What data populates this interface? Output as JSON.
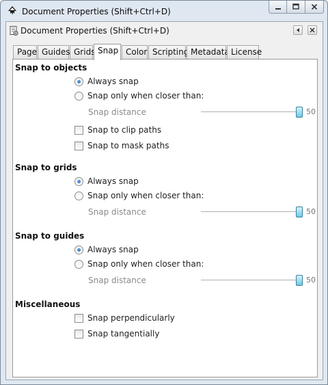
{
  "window": {
    "title": "Document Properties (Shift+Ctrl+D)",
    "dock_title": "Document Properties (Shift+Ctrl+D)"
  },
  "tabs": [
    {
      "id": "page",
      "label": "Page",
      "active": false
    },
    {
      "id": "guides",
      "label": "Guides",
      "active": false
    },
    {
      "id": "grids",
      "label": "Grids",
      "active": false
    },
    {
      "id": "snap",
      "label": "Snap",
      "active": true
    },
    {
      "id": "color",
      "label": "Color",
      "active": false
    },
    {
      "id": "scripting",
      "label": "Scripting",
      "active": false
    },
    {
      "id": "metadata",
      "label": "Metadata",
      "active": false
    },
    {
      "id": "license",
      "label": "License",
      "active": false
    }
  ],
  "snap_objects": {
    "title": "Snap to objects",
    "always_snap": "Always snap",
    "closer_than": "Snap only when closer than:",
    "distance_label": "Snap distance",
    "distance_value": "50",
    "clip_paths": "Snap to clip paths",
    "mask_paths": "Snap to mask paths"
  },
  "snap_grids": {
    "title": "Snap to grids",
    "always_snap": "Always snap",
    "closer_than": "Snap only when closer than:",
    "distance_label": "Snap distance",
    "distance_value": "50"
  },
  "snap_guides": {
    "title": "Snap to guides",
    "always_snap": "Always snap",
    "closer_than": "Snap only when closer than:",
    "distance_label": "Snap distance",
    "distance_value": "50"
  },
  "misc": {
    "title": "Miscellaneous",
    "perpendicularly": "Snap perpendicularly",
    "tangentially": "Snap tangentially"
  },
  "icons": {
    "app": "inkscape-icon",
    "dock": "document-properties-icon",
    "minimize": "minimize-icon",
    "maximize": "maximize-icon",
    "close": "close-icon"
  },
  "colors": {
    "accent": "#1f58ab",
    "slider_handle": "#6cc9ea",
    "frame": "#dfe7f1"
  }
}
